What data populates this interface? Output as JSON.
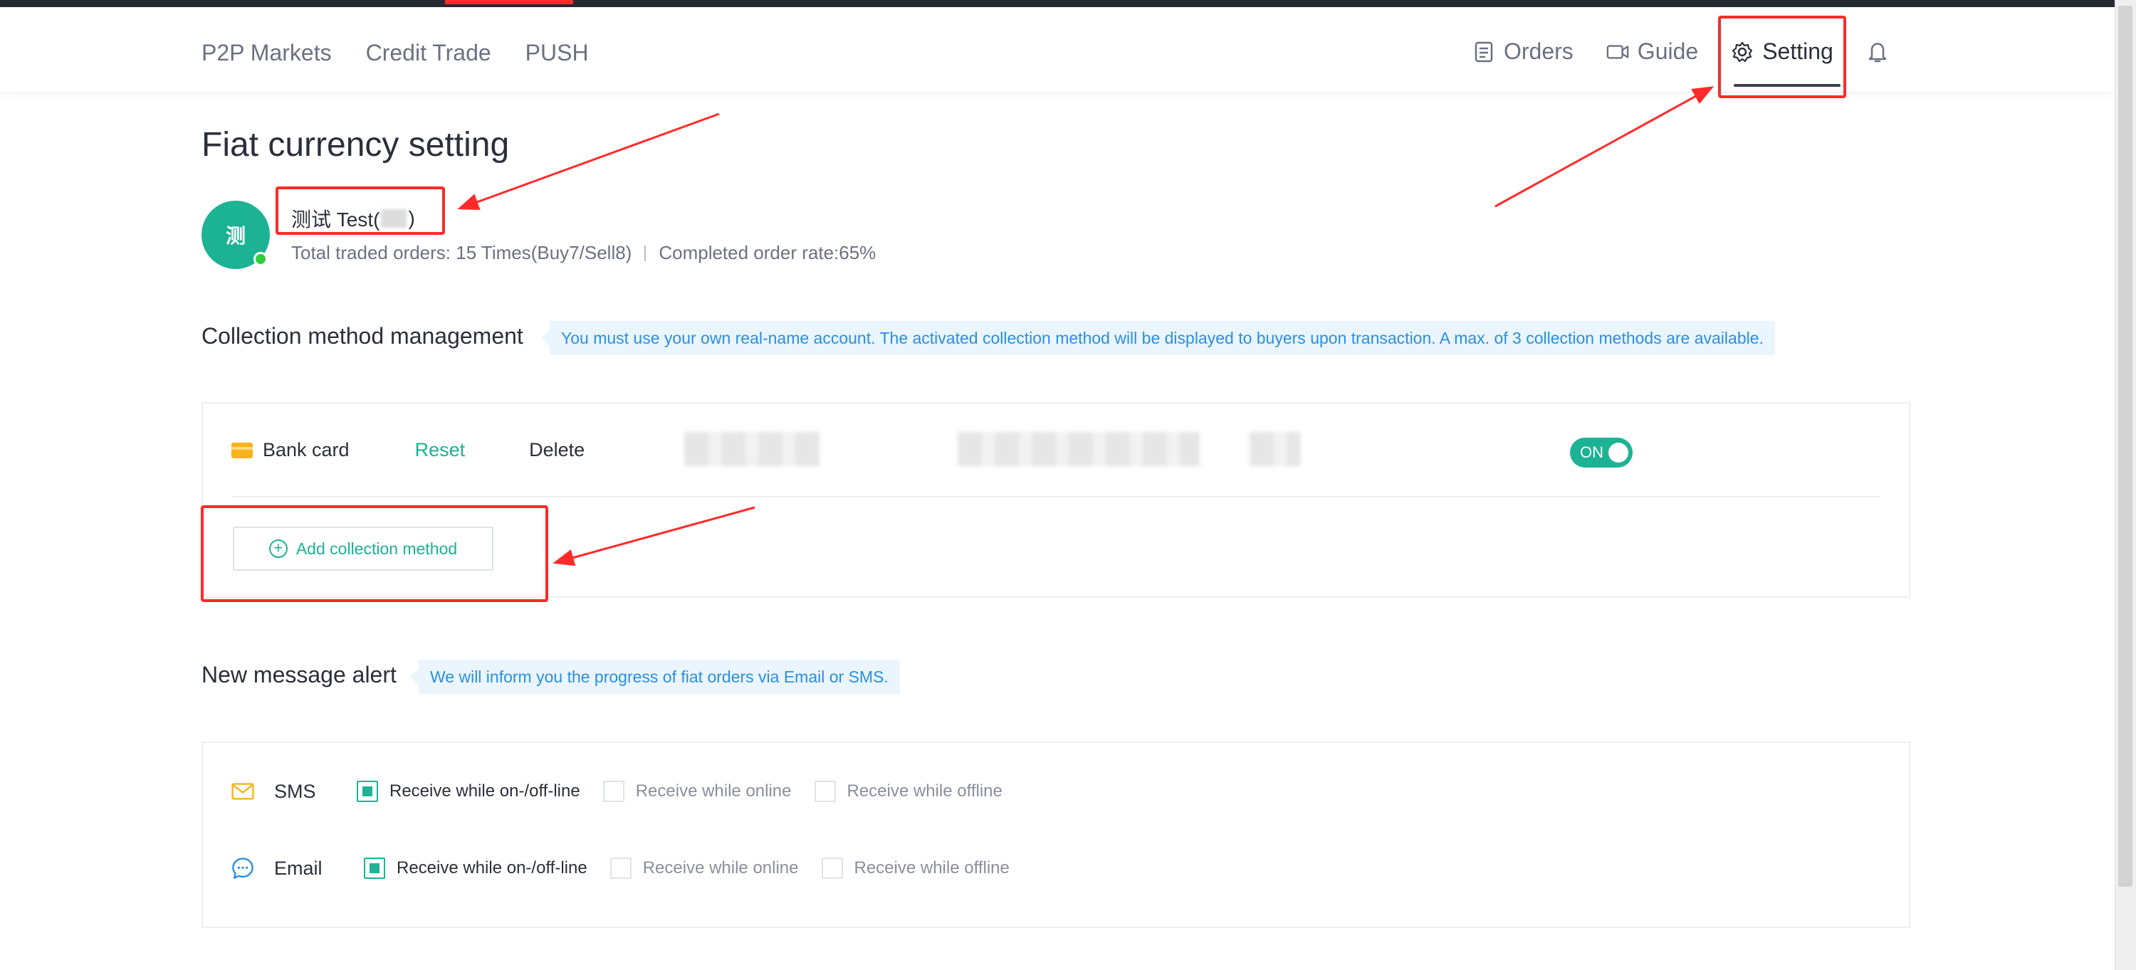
{
  "nav": {
    "left": [
      "P2P Markets",
      "Credit Trade",
      "PUSH"
    ],
    "orders": "Orders",
    "guide": "Guide",
    "setting": "Setting"
  },
  "page": {
    "title": "Fiat currency setting"
  },
  "user": {
    "avatar": "测",
    "name_prefix": "测试 Test(",
    "name_suffix": ")",
    "stats_orders": "Total traded orders: 15 Times(Buy7/Sell8)",
    "stats_rate": "Completed order rate:65%"
  },
  "collection": {
    "title": "Collection method management",
    "tip": "You must use your own real-name account. The activated collection method will be displayed to buyers upon transaction. A max. of 3 collection methods are available.",
    "method": "Bank card",
    "reset": "Reset",
    "delete": "Delete",
    "toggle": "ON",
    "add": "Add collection method"
  },
  "alerts": {
    "title": "New message alert",
    "tip": "We will inform you the progress of fiat orders via Email or SMS.",
    "rows": [
      {
        "label": "SMS",
        "options": [
          "Receive while on-/off-line",
          "Receive while online",
          "Receive while offline"
        ]
      },
      {
        "label": "Email",
        "options": [
          "Receive while on-/off-line",
          "Receive while online",
          "Receive while offline"
        ]
      }
    ]
  },
  "colors": {
    "brand_green": "#1bb394",
    "annotation_red": "#ff2a2a",
    "tip_blue": "#2b8fe0",
    "card_orange": "#f7b21d"
  }
}
